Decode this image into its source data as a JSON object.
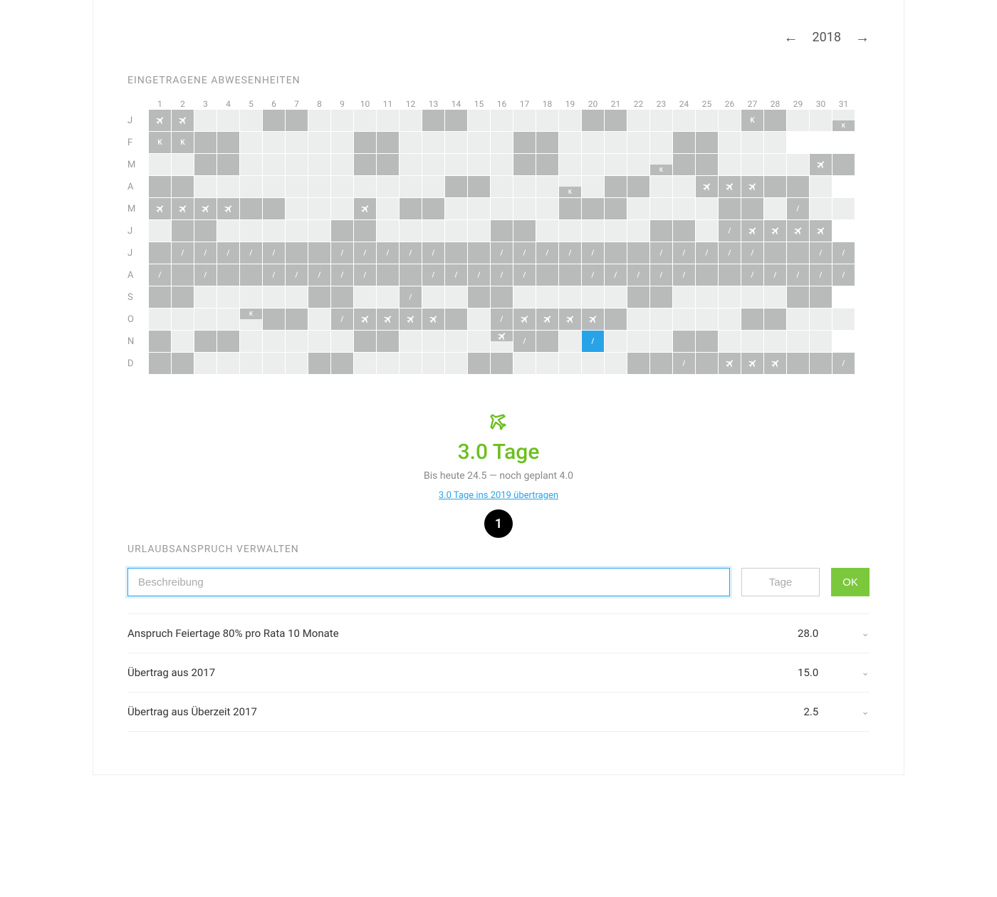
{
  "yearNav": {
    "year": "2018"
  },
  "sectionAbsences": "Eingetragene Abwesenheiten",
  "sectionManage": "Urlaubsanspruch verwalten",
  "days": [
    "1",
    "2",
    "3",
    "4",
    "5",
    "6",
    "7",
    "8",
    "9",
    "10",
    "11",
    "12",
    "13",
    "14",
    "15",
    "16",
    "17",
    "18",
    "19",
    "20",
    "21",
    "22",
    "23",
    "24",
    "25",
    "26",
    "27",
    "28",
    "29",
    "30",
    "31"
  ],
  "months": [
    "J",
    "F",
    "M",
    "A",
    "M",
    "J",
    "J",
    "A",
    "S",
    "O",
    "N",
    "D"
  ],
  "calendar": {
    "J": [
      {
        "s": "d",
        "i": "p"
      },
      {
        "s": "d",
        "i": "p"
      },
      {
        "s": "l"
      },
      {
        "s": "l"
      },
      {
        "s": "l"
      },
      {
        "s": "d"
      },
      {
        "s": "d"
      },
      {
        "s": "l"
      },
      {
        "s": "l"
      },
      {
        "s": "l"
      },
      {
        "s": "l"
      },
      {
        "s": "l"
      },
      {
        "s": "d"
      },
      {
        "s": "d"
      },
      {
        "s": "l"
      },
      {
        "s": "l"
      },
      {
        "s": "l"
      },
      {
        "s": "l"
      },
      {
        "s": "l"
      },
      {
        "s": "d"
      },
      {
        "s": "d"
      },
      {
        "s": "l"
      },
      {
        "s": "l"
      },
      {
        "s": "l"
      },
      {
        "s": "l"
      },
      {
        "s": "l"
      },
      {
        "s": "d",
        "t": "K"
      },
      {
        "s": "d"
      },
      {
        "s": "l"
      },
      {
        "s": "l"
      },
      {
        "s": "l",
        "hb": {
          "s": "d",
          "t": "K"
        }
      }
    ],
    "F": [
      {
        "s": "d",
        "t": "K"
      },
      {
        "s": "d",
        "t": "K"
      },
      {
        "s": "d"
      },
      {
        "s": "d"
      },
      {
        "s": "l"
      },
      {
        "s": "l"
      },
      {
        "s": "l"
      },
      {
        "s": "l"
      },
      {
        "s": "l"
      },
      {
        "s": "d"
      },
      {
        "s": "d"
      },
      {
        "s": "l"
      },
      {
        "s": "l"
      },
      {
        "s": "l"
      },
      {
        "s": "l"
      },
      {
        "s": "l"
      },
      {
        "s": "d"
      },
      {
        "s": "d"
      },
      {
        "s": "l"
      },
      {
        "s": "l"
      },
      {
        "s": "l"
      },
      {
        "s": "l"
      },
      {
        "s": "l"
      },
      {
        "s": "d"
      },
      {
        "s": "d"
      },
      {
        "s": "l"
      },
      {
        "s": "l"
      },
      {
        "s": "l"
      },
      {
        "s": "e"
      },
      {
        "s": "e"
      },
      {
        "s": "e"
      }
    ],
    "M": [
      {
        "s": "l"
      },
      {
        "s": "l"
      },
      {
        "s": "d"
      },
      {
        "s": "d"
      },
      {
        "s": "l"
      },
      {
        "s": "l"
      },
      {
        "s": "l"
      },
      {
        "s": "l"
      },
      {
        "s": "l"
      },
      {
        "s": "d"
      },
      {
        "s": "d"
      },
      {
        "s": "l"
      },
      {
        "s": "l"
      },
      {
        "s": "l"
      },
      {
        "s": "l"
      },
      {
        "s": "l"
      },
      {
        "s": "d"
      },
      {
        "s": "d"
      },
      {
        "s": "l"
      },
      {
        "s": "l"
      },
      {
        "s": "l"
      },
      {
        "s": "l"
      },
      {
        "s": "l",
        "hb": {
          "s": "d",
          "t": "K"
        }
      },
      {
        "s": "d"
      },
      {
        "s": "d"
      },
      {
        "s": "l"
      },
      {
        "s": "l"
      },
      {
        "s": "l"
      },
      {
        "s": "l"
      },
      {
        "s": "d",
        "i": "p"
      },
      {
        "s": "d"
      }
    ],
    "A": [
      {
        "s": "d"
      },
      {
        "s": "d"
      },
      {
        "s": "l"
      },
      {
        "s": "l"
      },
      {
        "s": "l"
      },
      {
        "s": "l"
      },
      {
        "s": "l"
      },
      {
        "s": "l"
      },
      {
        "s": "l"
      },
      {
        "s": "l"
      },
      {
        "s": "l"
      },
      {
        "s": "l"
      },
      {
        "s": "l"
      },
      {
        "s": "d"
      },
      {
        "s": "d"
      },
      {
        "s": "l"
      },
      {
        "s": "l"
      },
      {
        "s": "l"
      },
      {
        "s": "l",
        "hb": {
          "s": "d",
          "t": "K"
        }
      },
      {
        "s": "l"
      },
      {
        "s": "d"
      },
      {
        "s": "d"
      },
      {
        "s": "l"
      },
      {
        "s": "l"
      },
      {
        "s": "d",
        "i": "p"
      },
      {
        "s": "d",
        "i": "p"
      },
      {
        "s": "d",
        "i": "p"
      },
      {
        "s": "d"
      },
      {
        "s": "d"
      },
      {
        "s": "l"
      },
      {
        "s": "e"
      }
    ],
    "M2": [
      {
        "s": "d",
        "i": "p"
      },
      {
        "s": "d",
        "i": "p"
      },
      {
        "s": "d",
        "i": "p"
      },
      {
        "s": "d",
        "i": "p"
      },
      {
        "s": "d"
      },
      {
        "s": "d"
      },
      {
        "s": "l"
      },
      {
        "s": "l"
      },
      {
        "s": "l"
      },
      {
        "s": "d",
        "i": "p"
      },
      {
        "s": "l"
      },
      {
        "s": "d"
      },
      {
        "s": "d"
      },
      {
        "s": "l"
      },
      {
        "s": "l"
      },
      {
        "s": "l"
      },
      {
        "s": "l"
      },
      {
        "s": "l"
      },
      {
        "s": "d"
      },
      {
        "s": "d"
      },
      {
        "s": "d"
      },
      {
        "s": "l"
      },
      {
        "s": "l"
      },
      {
        "s": "l"
      },
      {
        "s": "l"
      },
      {
        "s": "d"
      },
      {
        "s": "d"
      },
      {
        "s": "l"
      },
      {
        "s": "d",
        "t": "/"
      },
      {
        "s": "l"
      },
      {
        "s": "l"
      }
    ],
    "J2": [
      {
        "s": "l"
      },
      {
        "s": "d"
      },
      {
        "s": "d"
      },
      {
        "s": "l"
      },
      {
        "s": "l"
      },
      {
        "s": "l"
      },
      {
        "s": "l"
      },
      {
        "s": "l"
      },
      {
        "s": "d"
      },
      {
        "s": "d"
      },
      {
        "s": "l"
      },
      {
        "s": "l"
      },
      {
        "s": "l"
      },
      {
        "s": "l"
      },
      {
        "s": "l"
      },
      {
        "s": "d"
      },
      {
        "s": "d"
      },
      {
        "s": "l"
      },
      {
        "s": "l"
      },
      {
        "s": "l"
      },
      {
        "s": "l"
      },
      {
        "s": "l"
      },
      {
        "s": "d"
      },
      {
        "s": "d"
      },
      {
        "s": "l"
      },
      {
        "s": "d",
        "t": "/"
      },
      {
        "s": "d",
        "i": "p"
      },
      {
        "s": "d",
        "i": "p"
      },
      {
        "s": "d",
        "i": "p"
      },
      {
        "s": "d",
        "i": "p"
      },
      {
        "s": "e"
      }
    ],
    "J3": [
      {
        "s": "d"
      },
      {
        "s": "d",
        "t": "/"
      },
      {
        "s": "d",
        "t": "/"
      },
      {
        "s": "d",
        "t": "/"
      },
      {
        "s": "d",
        "t": "/"
      },
      {
        "s": "d",
        "t": "/"
      },
      {
        "s": "d"
      },
      {
        "s": "d"
      },
      {
        "s": "d",
        "t": "/"
      },
      {
        "s": "d",
        "t": "/"
      },
      {
        "s": "d",
        "t": "/"
      },
      {
        "s": "d",
        "t": "/"
      },
      {
        "s": "d",
        "t": "/"
      },
      {
        "s": "d"
      },
      {
        "s": "d"
      },
      {
        "s": "d",
        "t": "/"
      },
      {
        "s": "d",
        "t": "/"
      },
      {
        "s": "d",
        "t": "/"
      },
      {
        "s": "d",
        "t": "/"
      },
      {
        "s": "d",
        "t": "/"
      },
      {
        "s": "d"
      },
      {
        "s": "d"
      },
      {
        "s": "d",
        "t": "/"
      },
      {
        "s": "d",
        "t": "/"
      },
      {
        "s": "d",
        "t": "/"
      },
      {
        "s": "d",
        "t": "/"
      },
      {
        "s": "d",
        "t": "/"
      },
      {
        "s": "d"
      },
      {
        "s": "d"
      },
      {
        "s": "d",
        "t": "/"
      },
      {
        "s": "d",
        "t": "/"
      }
    ],
    "A2": [
      {
        "s": "d",
        "t": "/"
      },
      {
        "s": "d"
      },
      {
        "s": "d",
        "t": "/"
      },
      {
        "s": "d"
      },
      {
        "s": "d"
      },
      {
        "s": "d",
        "t": "/"
      },
      {
        "s": "d",
        "t": "/"
      },
      {
        "s": "d",
        "t": "/"
      },
      {
        "s": "d",
        "t": "/"
      },
      {
        "s": "d",
        "t": "/"
      },
      {
        "s": "d"
      },
      {
        "s": "d"
      },
      {
        "s": "d",
        "t": "/"
      },
      {
        "s": "d",
        "t": "/"
      },
      {
        "s": "d",
        "t": "/"
      },
      {
        "s": "d",
        "t": "/"
      },
      {
        "s": "d",
        "t": "/"
      },
      {
        "s": "d"
      },
      {
        "s": "d"
      },
      {
        "s": "d",
        "t": "/"
      },
      {
        "s": "d",
        "t": "/"
      },
      {
        "s": "d",
        "t": "/"
      },
      {
        "s": "d",
        "t": "/"
      },
      {
        "s": "d",
        "t": "/"
      },
      {
        "s": "d"
      },
      {
        "s": "d"
      },
      {
        "s": "d",
        "t": "/"
      },
      {
        "s": "d",
        "t": "/"
      },
      {
        "s": "d",
        "t": "/"
      },
      {
        "s": "d",
        "t": "/"
      },
      {
        "s": "d",
        "t": "/"
      }
    ],
    "S2": [
      {
        "s": "d"
      },
      {
        "s": "d"
      },
      {
        "s": "l"
      },
      {
        "s": "l"
      },
      {
        "s": "l"
      },
      {
        "s": "l"
      },
      {
        "s": "l"
      },
      {
        "s": "d"
      },
      {
        "s": "d"
      },
      {
        "s": "l"
      },
      {
        "s": "l"
      },
      {
        "s": "d",
        "t": "/"
      },
      {
        "s": "l"
      },
      {
        "s": "l"
      },
      {
        "s": "d"
      },
      {
        "s": "d"
      },
      {
        "s": "l"
      },
      {
        "s": "l"
      },
      {
        "s": "l"
      },
      {
        "s": "l"
      },
      {
        "s": "l"
      },
      {
        "s": "d"
      },
      {
        "s": "d"
      },
      {
        "s": "l"
      },
      {
        "s": "l"
      },
      {
        "s": "l"
      },
      {
        "s": "l"
      },
      {
        "s": "l"
      },
      {
        "s": "d"
      },
      {
        "s": "d"
      },
      {
        "s": "e"
      }
    ],
    "O": [
      {
        "s": "l"
      },
      {
        "s": "l"
      },
      {
        "s": "l"
      },
      {
        "s": "l"
      },
      {
        "s": "l",
        "ht": {
          "s": "d",
          "t": "K"
        }
      },
      {
        "s": "d"
      },
      {
        "s": "d"
      },
      {
        "s": "l"
      },
      {
        "s": "d",
        "t": "/"
      },
      {
        "s": "d",
        "i": "p"
      },
      {
        "s": "d",
        "i": "p"
      },
      {
        "s": "d",
        "i": "p"
      },
      {
        "s": "d",
        "i": "p"
      },
      {
        "s": "d"
      },
      {
        "s": "l"
      },
      {
        "s": "d",
        "t": "/"
      },
      {
        "s": "d",
        "i": "p"
      },
      {
        "s": "d",
        "i": "p"
      },
      {
        "s": "d",
        "i": "p"
      },
      {
        "s": "d",
        "i": "p"
      },
      {
        "s": "d"
      },
      {
        "s": "l"
      },
      {
        "s": "l"
      },
      {
        "s": "l"
      },
      {
        "s": "l"
      },
      {
        "s": "l"
      },
      {
        "s": "d"
      },
      {
        "s": "d"
      },
      {
        "s": "l"
      },
      {
        "s": "l"
      },
      {
        "s": "l"
      }
    ],
    "N": [
      {
        "s": "d"
      },
      {
        "s": "l"
      },
      {
        "s": "d"
      },
      {
        "s": "d"
      },
      {
        "s": "l"
      },
      {
        "s": "l"
      },
      {
        "s": "l"
      },
      {
        "s": "l"
      },
      {
        "s": "l"
      },
      {
        "s": "d"
      },
      {
        "s": "d"
      },
      {
        "s": "l"
      },
      {
        "s": "l"
      },
      {
        "s": "l"
      },
      {
        "s": "l"
      },
      {
        "s": "l",
        "ht": {
          "s": "d",
          "i": "p"
        }
      },
      {
        "s": "d",
        "t": "/"
      },
      {
        "s": "d"
      },
      {
        "s": "l"
      },
      {
        "s": "b",
        "t": "/"
      },
      {
        "s": "l"
      },
      {
        "s": "l"
      },
      {
        "s": "l"
      },
      {
        "s": "d"
      },
      {
        "s": "d"
      },
      {
        "s": "l"
      },
      {
        "s": "l"
      },
      {
        "s": "l"
      },
      {
        "s": "l"
      },
      {
        "s": "l"
      },
      {
        "s": "e"
      }
    ],
    "D": [
      {
        "s": "d"
      },
      {
        "s": "d"
      },
      {
        "s": "l"
      },
      {
        "s": "l"
      },
      {
        "s": "l"
      },
      {
        "s": "l"
      },
      {
        "s": "l"
      },
      {
        "s": "d"
      },
      {
        "s": "d"
      },
      {
        "s": "l"
      },
      {
        "s": "l"
      },
      {
        "s": "l"
      },
      {
        "s": "l"
      },
      {
        "s": "l"
      },
      {
        "s": "d"
      },
      {
        "s": "d"
      },
      {
        "s": "l"
      },
      {
        "s": "l"
      },
      {
        "s": "l"
      },
      {
        "s": "l"
      },
      {
        "s": "l"
      },
      {
        "s": "d"
      },
      {
        "s": "d"
      },
      {
        "s": "d",
        "t": "/"
      },
      {
        "s": "d"
      },
      {
        "s": "d",
        "i": "p"
      },
      {
        "s": "d",
        "i": "p"
      },
      {
        "s": "d",
        "i": "p"
      },
      {
        "s": "d"
      },
      {
        "s": "d"
      },
      {
        "s": "d",
        "t": "/"
      }
    ]
  },
  "monthKeys": [
    "J",
    "F",
    "M",
    "A",
    "M2",
    "J2",
    "J3",
    "A2",
    "S2",
    "O",
    "N",
    "D"
  ],
  "summary": {
    "big": "3.0 Tage",
    "sub": "Bis heute 24.5 — noch geplant 4.0",
    "link": "3.0 Tage ins 2019 übertragen"
  },
  "badge": "1",
  "inputs": {
    "descPlaceholder": "Beschreibung",
    "daysPlaceholder": "Tage",
    "ok": "OK"
  },
  "entitlements": [
    {
      "label": "Anspruch Feiertage 80% pro Rata 10 Monate",
      "value": "28.0"
    },
    {
      "label": "Übertrag aus 2017",
      "value": "15.0"
    },
    {
      "label": "Übertrag aus Überzeit 2017",
      "value": "2.5"
    }
  ]
}
